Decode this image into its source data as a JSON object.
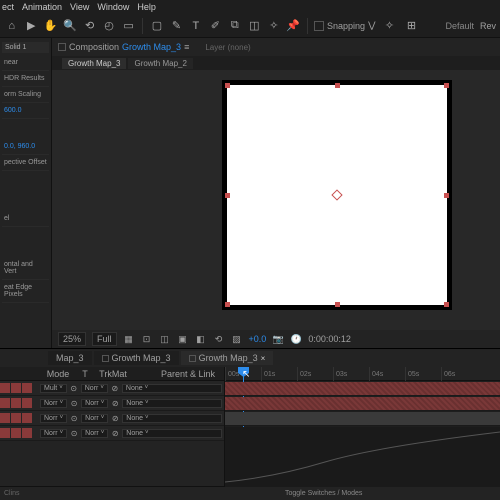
{
  "menu": [
    "ect",
    "Animation",
    "View",
    "Window",
    "Help"
  ],
  "toolbar": {
    "ws": "Default",
    "ws2": "Rev",
    "snap": "Snapping"
  },
  "left": {
    "tab": "Solid 1",
    "items": [
      "near",
      "",
      "HDR Results",
      "",
      "orm Scaling"
    ],
    "val1": "600.0",
    "offs": "0.0, 960.0",
    "offs_lbl": "pective Offset",
    "edge1": "ontal and Vert",
    "edge2": "eat Edge Pixels",
    "sep_lbl": "el"
  },
  "comp": {
    "panel_lbl": "Composition",
    "name": "Growth Map_3",
    "extra": "≡",
    "layer_none": "Layer  (none)",
    "tabs": [
      "Growth Map_3",
      "Growth Map_2"
    ]
  },
  "viewer": {
    "zoom": "25%",
    "res": "Full",
    "exp": "+0.0",
    "time": "0:00:00:12"
  },
  "timeline": {
    "tabs": [
      "Map_3",
      "Growth Map_3",
      "Growth Map_3"
    ],
    "cols": {
      "mode": "Mode",
      "t": "T",
      "trk": "TrkMat",
      "parent": "Parent & Link"
    },
    "rows": [
      {
        "mode": "Mult",
        "trk": "",
        "parent": "None"
      },
      {
        "mode": "Norr",
        "trk": "Norr",
        "parent": "None"
      },
      {
        "mode": "Norr",
        "trk": "Norr",
        "parent": "None"
      },
      {
        "mode": "Norr",
        "trk": "Norr",
        "parent": "None"
      }
    ],
    "ticks": [
      "00s",
      "01s",
      "02s",
      "03s",
      "04s",
      "05s",
      "06s"
    ],
    "foot_l": "Clins",
    "foot_r": "Toggle Switches / Modes"
  }
}
